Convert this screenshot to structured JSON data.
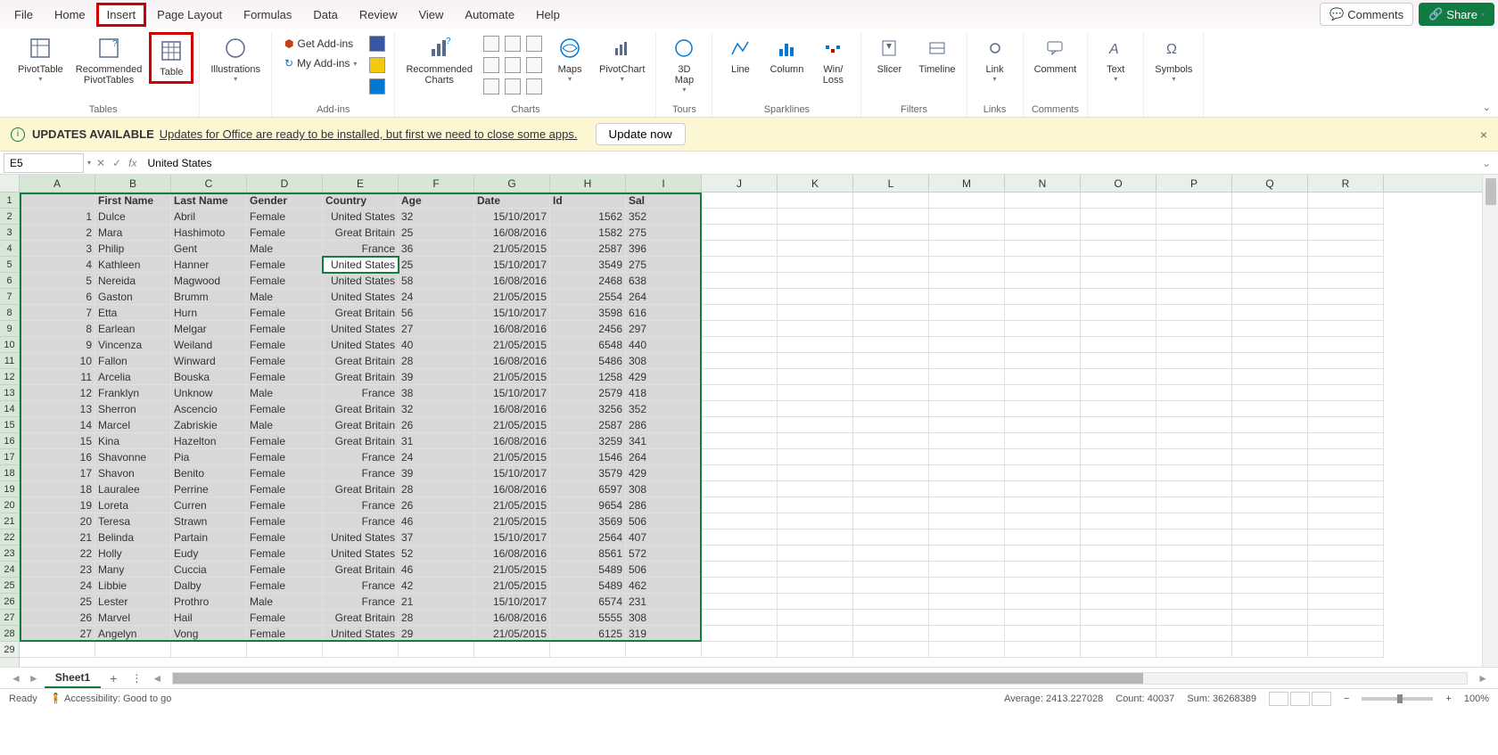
{
  "menu": {
    "items": [
      "File",
      "Home",
      "Insert",
      "Page Layout",
      "Formulas",
      "Data",
      "Review",
      "View",
      "Automate",
      "Help"
    ],
    "highlighted_index": 2,
    "comments": "Comments",
    "share": "Share"
  },
  "ribbon": {
    "groups": {
      "tables": {
        "label": "Tables",
        "pivot": "PivotTable",
        "recommended_pivot": "Recommended\nPivotTables",
        "table": "Table"
      },
      "illustrations": {
        "btn": "Illustrations"
      },
      "addins": {
        "label": "Add-ins",
        "get": "Get Add-ins",
        "my": "My Add-ins"
      },
      "charts": {
        "label": "Charts",
        "recommended": "Recommended\nCharts",
        "maps": "Maps",
        "pivotchart": "PivotChart"
      },
      "tours": {
        "label": "Tours",
        "map3d": "3D\nMap"
      },
      "sparklines": {
        "label": "Sparklines",
        "line": "Line",
        "column": "Column",
        "winloss": "Win/\nLoss"
      },
      "filters": {
        "label": "Filters",
        "slicer": "Slicer",
        "timeline": "Timeline"
      },
      "links": {
        "label": "Links",
        "link": "Link"
      },
      "comments": {
        "label": "Comments",
        "comment": "Comment"
      },
      "text": {
        "btn": "Text"
      },
      "symbols": {
        "btn": "Symbols"
      }
    }
  },
  "update_bar": {
    "title": "UPDATES AVAILABLE",
    "message": "Updates for Office are ready to be installed, but first we need to close some apps.",
    "button": "Update now"
  },
  "formula_bar": {
    "name_box": "E5",
    "formula": "United States"
  },
  "columns": [
    "A",
    "B",
    "C",
    "D",
    "E",
    "F",
    "G",
    "H",
    "I",
    "J",
    "K",
    "L",
    "M",
    "N",
    "O",
    "P",
    "Q",
    "R"
  ],
  "selected_cols_count": 9,
  "visible_rows": 29,
  "active_cell": {
    "row": 5,
    "col": 5
  },
  "headers_row": [
    "",
    "First Name",
    "Last Name",
    "Gender",
    "Country",
    "Age",
    "Date",
    "Id",
    "Sal"
  ],
  "data_rows": [
    [
      "1",
      "Dulce",
      "Abril",
      "Female",
      "United States",
      "32",
      "15/10/2017",
      "1562",
      "352"
    ],
    [
      "2",
      "Mara",
      "Hashimoto",
      "Female",
      "Great Britain",
      "25",
      "16/08/2016",
      "1582",
      "275"
    ],
    [
      "3",
      "Philip",
      "Gent",
      "Male",
      "France",
      "36",
      "21/05/2015",
      "2587",
      "396"
    ],
    [
      "4",
      "Kathleen",
      "Hanner",
      "Female",
      "United States",
      "25",
      "15/10/2017",
      "3549",
      "275"
    ],
    [
      "5",
      "Nereida",
      "Magwood",
      "Female",
      "United States",
      "58",
      "16/08/2016",
      "2468",
      "638"
    ],
    [
      "6",
      "Gaston",
      "Brumm",
      "Male",
      "United States",
      "24",
      "21/05/2015",
      "2554",
      "264"
    ],
    [
      "7",
      "Etta",
      "Hurn",
      "Female",
      "Great Britain",
      "56",
      "15/10/2017",
      "3598",
      "616"
    ],
    [
      "8",
      "Earlean",
      "Melgar",
      "Female",
      "United States",
      "27",
      "16/08/2016",
      "2456",
      "297"
    ],
    [
      "9",
      "Vincenza",
      "Weiland",
      "Female",
      "United States",
      "40",
      "21/05/2015",
      "6548",
      "440"
    ],
    [
      "10",
      "Fallon",
      "Winward",
      "Female",
      "Great Britain",
      "28",
      "16/08/2016",
      "5486",
      "308"
    ],
    [
      "11",
      "Arcelia",
      "Bouska",
      "Female",
      "Great Britain",
      "39",
      "21/05/2015",
      "1258",
      "429"
    ],
    [
      "12",
      "Franklyn",
      "Unknow",
      "Male",
      "France",
      "38",
      "15/10/2017",
      "2579",
      "418"
    ],
    [
      "13",
      "Sherron",
      "Ascencio",
      "Female",
      "Great Britain",
      "32",
      "16/08/2016",
      "3256",
      "352"
    ],
    [
      "14",
      "Marcel",
      "Zabriskie",
      "Male",
      "Great Britain",
      "26",
      "21/05/2015",
      "2587",
      "286"
    ],
    [
      "15",
      "Kina",
      "Hazelton",
      "Female",
      "Great Britain",
      "31",
      "16/08/2016",
      "3259",
      "341"
    ],
    [
      "16",
      "Shavonne",
      "Pia",
      "Female",
      "France",
      "24",
      "21/05/2015",
      "1546",
      "264"
    ],
    [
      "17",
      "Shavon",
      "Benito",
      "Female",
      "France",
      "39",
      "15/10/2017",
      "3579",
      "429"
    ],
    [
      "18",
      "Lauralee",
      "Perrine",
      "Female",
      "Great Britain",
      "28",
      "16/08/2016",
      "6597",
      "308"
    ],
    [
      "19",
      "Loreta",
      "Curren",
      "Female",
      "France",
      "26",
      "21/05/2015",
      "9654",
      "286"
    ],
    [
      "20",
      "Teresa",
      "Strawn",
      "Female",
      "France",
      "46",
      "21/05/2015",
      "3569",
      "506"
    ],
    [
      "21",
      "Belinda",
      "Partain",
      "Female",
      "United States",
      "37",
      "15/10/2017",
      "2564",
      "407"
    ],
    [
      "22",
      "Holly",
      "Eudy",
      "Female",
      "United States",
      "52",
      "16/08/2016",
      "8561",
      "572"
    ],
    [
      "23",
      "Many",
      "Cuccia",
      "Female",
      "Great Britain",
      "46",
      "21/05/2015",
      "5489",
      "506"
    ],
    [
      "24",
      "Libbie",
      "Dalby",
      "Female",
      "France",
      "42",
      "21/05/2015",
      "5489",
      "462"
    ],
    [
      "25",
      "Lester",
      "Prothro",
      "Male",
      "France",
      "21",
      "15/10/2017",
      "6574",
      "231"
    ],
    [
      "26",
      "Marvel",
      "Hail",
      "Female",
      "Great Britain",
      "28",
      "16/08/2016",
      "5555",
      "308"
    ],
    [
      "27",
      "Angelyn",
      "Vong",
      "Female",
      "United States",
      "29",
      "21/05/2015",
      "6125",
      "319"
    ]
  ],
  "numeric_cols": [
    0,
    4,
    6,
    7
  ],
  "sheet_tabs": {
    "active": "Sheet1"
  },
  "status_bar": {
    "ready": "Ready",
    "accessibility": "Accessibility: Good to go",
    "average": "Average: 2413.227028",
    "count": "Count: 40037",
    "sum": "Sum: 36268389",
    "zoom": "100%"
  }
}
